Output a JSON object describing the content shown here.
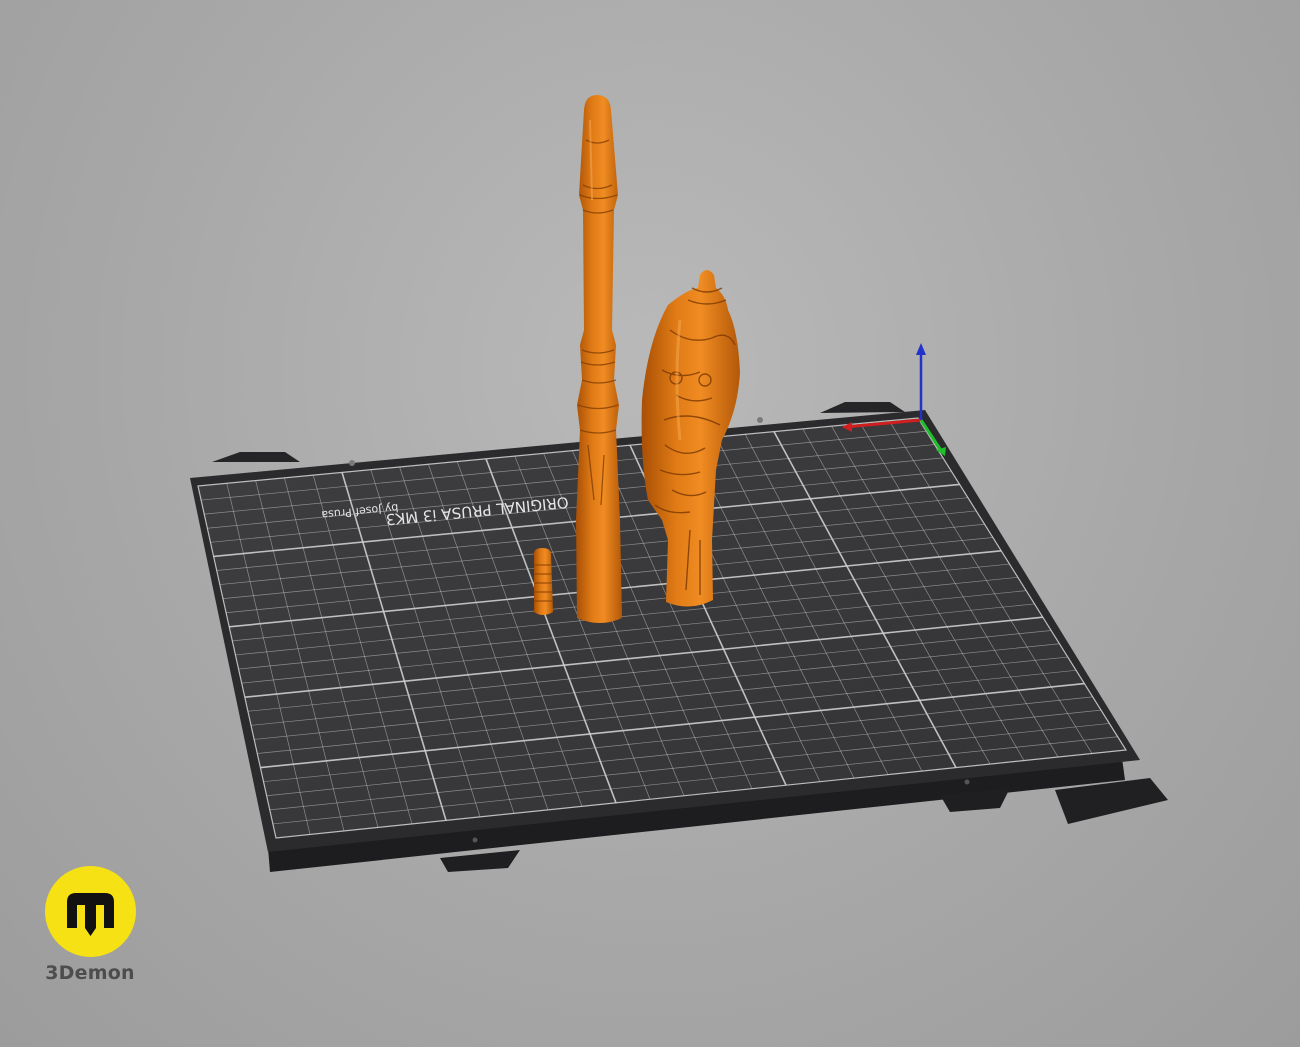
{
  "scene": {
    "background": "#a8a8a8",
    "bed": {
      "label_line1": "ORIGINAL PRUSA i3 MK3",
      "label_line2": "by Josef Prusa",
      "bed_color": "#2b2b2d",
      "plate_color": "#3a3a3c",
      "grid_color": "#cfcfcf"
    },
    "objects": [
      {
        "name": "tall-staff-part",
        "color": "#d4700f"
      },
      {
        "name": "carved-head-part",
        "color": "#d4700f"
      },
      {
        "name": "small-ring-part",
        "color": "#d4700f"
      }
    ],
    "axes": {
      "x_color": "#d11f1f",
      "y_color": "#1fbf2a",
      "z_color": "#2233cc"
    }
  },
  "logo": {
    "brand": "3Demon",
    "badge_color": "#f6e114",
    "icon": "3demon-m-icon"
  }
}
